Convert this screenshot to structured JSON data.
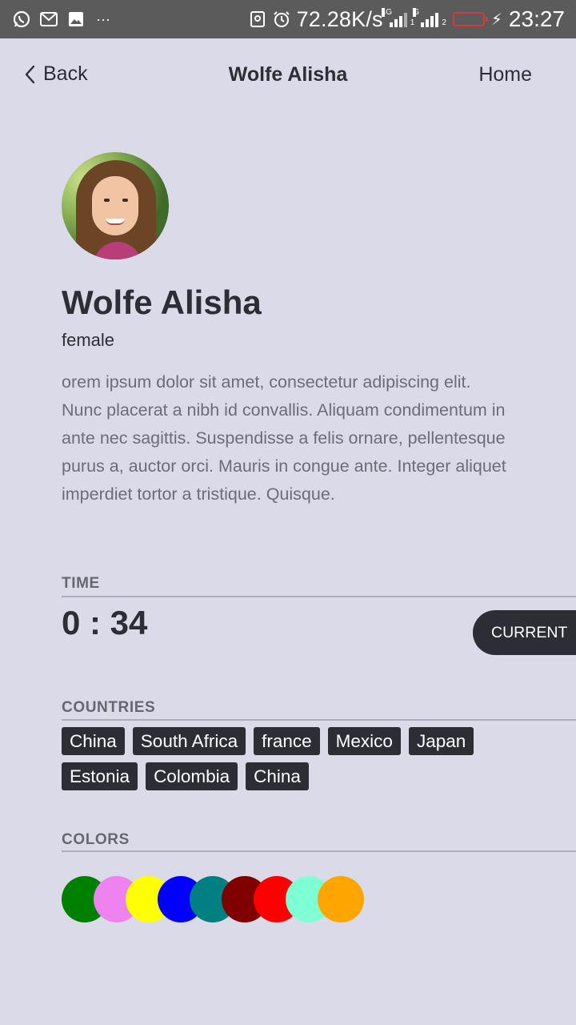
{
  "status_bar": {
    "speed": "72.28K/s",
    "time": "23:27",
    "more": "···",
    "sim1_tag": "4G",
    "sim1_index": "1",
    "sim2_tag": "G",
    "sim2_index": "2"
  },
  "nav": {
    "back_label": "Back",
    "title": "Wolfe Alisha",
    "home_label": "Home"
  },
  "profile": {
    "name": "Wolfe Alisha",
    "gender": "female",
    "bio": "orem ipsum dolor sit amet, consectetur adipiscing elit. Nunc placerat a nibh id convallis. Aliquam condimentum in ante nec sagittis. Suspendisse a felis ornare, pellentesque purus a, auctor orci. Mauris in congue ante. Integer aliquet imperdiet tortor a tristique. Quisque."
  },
  "time": {
    "label": "TIME",
    "value": "0 : 34",
    "current_label": "CURRENT"
  },
  "countries": {
    "label": "COUNTRIES",
    "items": [
      "China",
      "South Africa",
      "france",
      "Mexico",
      "Japan",
      "Estonia",
      "Colombia",
      "China"
    ]
  },
  "colors": {
    "label": "COLORS",
    "items": [
      "#008000",
      "#ee82ee",
      "#ffff00",
      "#0000ff",
      "#008080",
      "#800000",
      "#ff0000",
      "#7fffd4",
      "#ffa500"
    ]
  }
}
